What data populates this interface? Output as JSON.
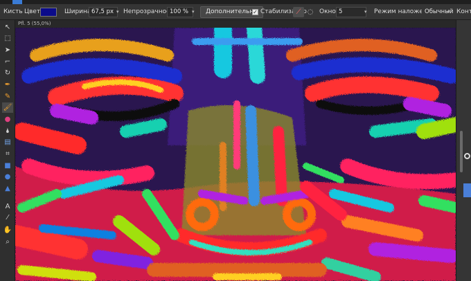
{
  "toolbar": {
    "tool_name": "Кисть",
    "color_label": "Цвет:",
    "color_value": "#0b0b8a",
    "width_label": "Ширина:",
    "width_value": "67,5 px",
    "opacity_label": "Непрозрачность:",
    "opacity_value": "100 %",
    "more_button": "Дополнительно",
    "stabilizer_label": "Стабилизатор",
    "window_label": "Окно:",
    "window_value": "5",
    "blend_label": "Режим наложения:",
    "blend_value": "Обычный",
    "contour_label": "Контр"
  },
  "document": {
    "tab_title": "Pfl. 5 (55,0%)"
  },
  "tools": [
    "move-icon",
    "selection-icon",
    "node-icon",
    "corner-icon",
    "rotate-icon",
    "pen-icon",
    "pencil-icon",
    "brush-icon",
    "color-picker-icon",
    "fill-icon",
    "gradient-icon",
    "crop-icon",
    "rectangle-icon",
    "ellipse-icon",
    "triangle-icon",
    "text-icon",
    "eyedropper-icon",
    "hand-icon",
    "zoom-icon"
  ],
  "colors": {
    "accent": "#3a7bd5",
    "brush_color": "#0b0b8a"
  }
}
